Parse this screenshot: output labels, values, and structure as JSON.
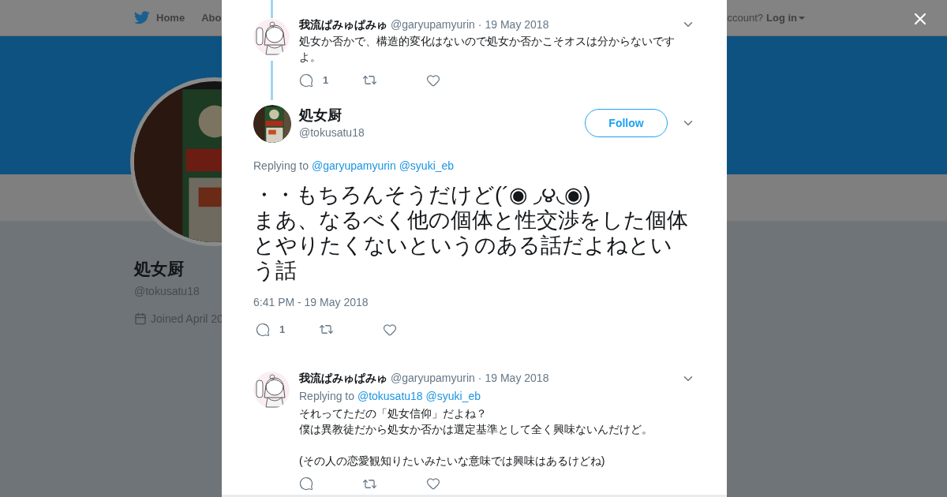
{
  "nav": {
    "items": [
      {
        "label": "Home",
        "kind": "home"
      },
      {
        "label": "Abo",
        "kind": "plain"
      }
    ],
    "account_prompt": "ccount?",
    "login": "Log in"
  },
  "profile": {
    "name": "処女厨",
    "handle": "@tokusatu18",
    "joined": "Joined April 20"
  },
  "tweets": [
    {
      "kind": "parent",
      "name": "我流ぱみゅぱみゅ",
      "handle": "@garyupamyurin",
      "separator": "·",
      "date": "19 May 2018",
      "paragraphs": [
        [
          "処女か否かで、構造的変化はないので処女か否かこそオスは分からないです",
          "よ。"
        ]
      ],
      "reply_count": "1"
    },
    {
      "kind": "main",
      "name": "処女厨",
      "handle": "@tokusatu18",
      "follow": "Follow",
      "replying_label": "Replying to",
      "mentions": [
        "@garyupamyurin",
        "@syuki_eb"
      ],
      "paragraphs": [
        [
          "・・もちろんそうだけど(´◉ ◞౪◟◉)",
          "まあ、なるべく他の個体と性交渉をした個体",
          "とやりたくないというのある話だよねとい",
          "う話"
        ]
      ],
      "timestamp": "6:41 PM - 19 May 2018",
      "reply_count": "1"
    },
    {
      "kind": "reply",
      "name": "我流ぱみゅぱみゅ",
      "handle": "@garyupamyurin",
      "separator": "·",
      "date": "19 May 2018",
      "replying_label": "Replying to",
      "mentions": [
        "@tokusatu18",
        "@syuki_eb"
      ],
      "paragraphs": [
        [
          "それってただの「処女信仰」だよね？",
          "僕は異教徒だから処女か否かは選定基準として全く興味ないんだけど。"
        ],
        [
          "(その人の恋愛観知りたいみたいな意味では興味はあるけどね)"
        ]
      ]
    }
  ]
}
